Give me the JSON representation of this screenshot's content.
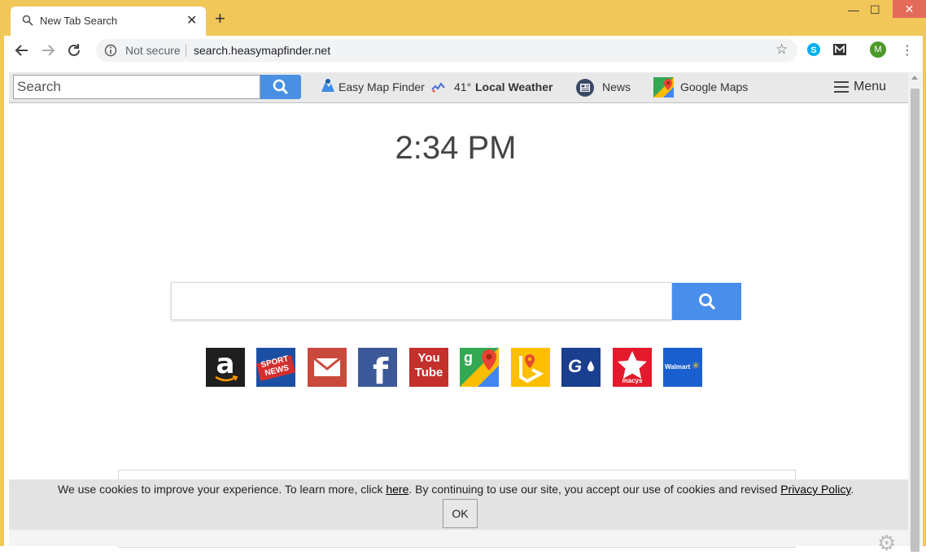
{
  "browser": {
    "tab_title": "New Tab Search",
    "new_tab": "+",
    "window_controls": {
      "minimize": "—",
      "maximize": "☐",
      "close": "✕"
    },
    "security_label": "Not secure",
    "url": "search.heasymapfinder.net",
    "avatar_letter": "M",
    "frame_color": "#f1c75a"
  },
  "topbar": {
    "search_placeholder": "Search",
    "links": {
      "easy_map_finder": "Easy Map Finder",
      "weather_temp": "41°",
      "weather_label": "Local Weather",
      "news": "News",
      "google_maps": "Google Maps",
      "menu": "Menu"
    }
  },
  "main": {
    "time": "2:34 PM",
    "search_button_color": "#4a8eec"
  },
  "shortcuts": [
    {
      "name": "amazon",
      "label": "a"
    },
    {
      "name": "sport-news",
      "label": "SPORT NEWS"
    },
    {
      "name": "gmail",
      "label": ""
    },
    {
      "name": "facebook",
      "label": "f"
    },
    {
      "name": "youtube",
      "label": "You Tube"
    },
    {
      "name": "google-maps",
      "label": "g"
    },
    {
      "name": "bing-maps",
      "label": ""
    },
    {
      "name": "gasbuddy",
      "label": "G"
    },
    {
      "name": "macys",
      "label": "macys"
    },
    {
      "name": "walmart",
      "label": "Walmart"
    }
  ],
  "cookie_banner": {
    "text_before": "We use cookies to improve your experience. To learn more, click ",
    "here_link": "here",
    "text_middle": ". By continuing to use our site, you accept our use of cookies and revised ",
    "privacy_link": "Privacy Policy",
    "text_after": ".",
    "ok_label": "OK"
  }
}
